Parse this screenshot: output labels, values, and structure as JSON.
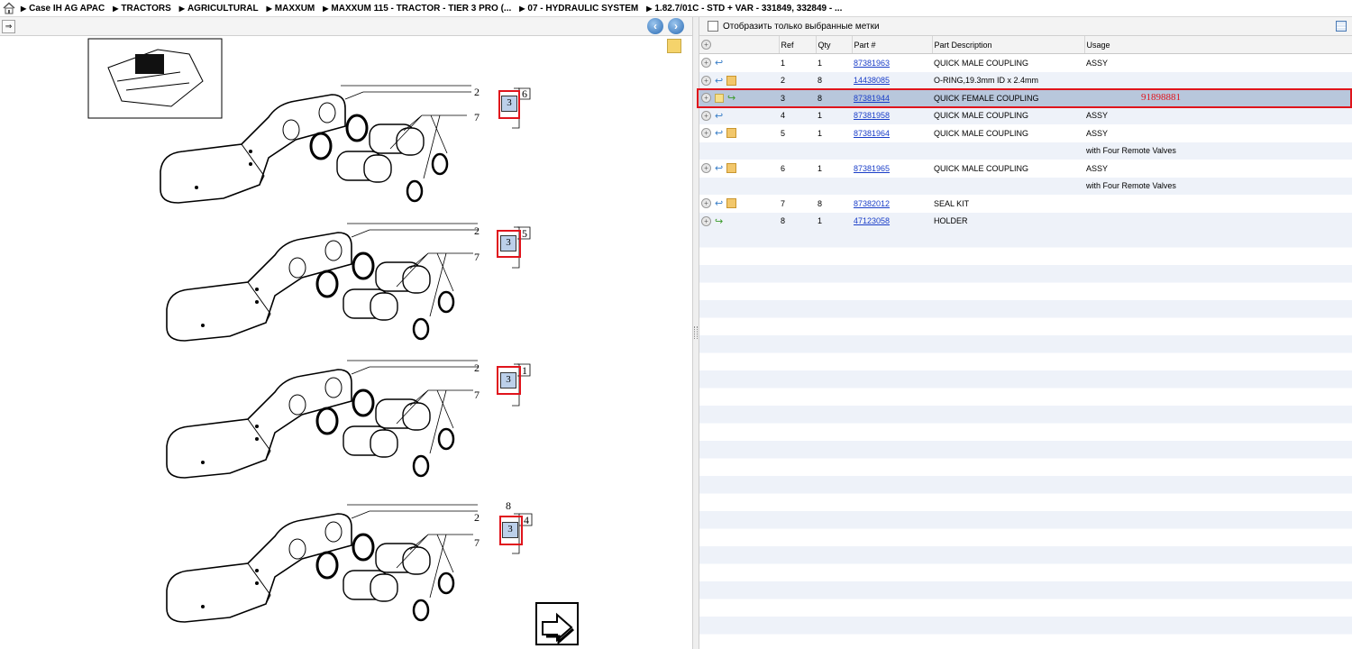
{
  "breadcrumb": [
    {
      "label": "Case IH AG APAC"
    },
    {
      "label": "TRACTORS"
    },
    {
      "label": "AGRICULTURAL"
    },
    {
      "label": "MAXXUM"
    },
    {
      "label": "MAXXUM 115 - TRACTOR - TIER 3 PRO (..."
    },
    {
      "label": "07 - HYDRAULIC SYSTEM"
    },
    {
      "label": "1.82.7/01C - STD + VAR - 331849, 332849 - ..."
    }
  ],
  "drawing": {
    "callouts": [
      "3",
      "3",
      "3",
      "3"
    ],
    "group_numbers": [
      "6",
      "5",
      "1",
      "4"
    ],
    "labels": [
      "2",
      "7"
    ],
    "holder_number": "8"
  },
  "right_panel": {
    "filter_label": "Отобразить только выбранные метки"
  },
  "table": {
    "headers": {
      "ref": "Ref",
      "qty": "Qty",
      "part": "Part #",
      "desc": "Part Description",
      "usage": "Usage"
    },
    "rows": [
      {
        "ref": "1",
        "qty": "1",
        "part": "87381963",
        "desc": "QUICK MALE COUPLING",
        "usage": "ASSY"
      },
      {
        "ref": "2",
        "qty": "8",
        "part": "14438085",
        "desc": "O-RING,19.3mm ID x 2.4mm",
        "usage": ""
      },
      {
        "ref": "3",
        "qty": "8",
        "part": "87381944",
        "desc": "QUICK FEMALE COUPLING",
        "usage": ""
      },
      {
        "ref": "4",
        "qty": "1",
        "part": "87381958",
        "desc": "QUICK MALE COUPLING",
        "usage": "ASSY"
      },
      {
        "ref": "5",
        "qty": "1",
        "part": "87381964",
        "desc": "QUICK MALE COUPLING",
        "usage": "ASSY"
      },
      {
        "ref": "",
        "qty": "",
        "part": "",
        "desc": "",
        "usage": "with Four Remote Valves"
      },
      {
        "ref": "6",
        "qty": "1",
        "part": "87381965",
        "desc": "QUICK MALE COUPLING",
        "usage": "ASSY"
      },
      {
        "ref": "",
        "qty": "",
        "part": "",
        "desc": "",
        "usage": "with Four Remote Valves"
      },
      {
        "ref": "7",
        "qty": "8",
        "part": "87382012",
        "desc": "SEAL KIT",
        "usage": ""
      },
      {
        "ref": "8",
        "qty": "1",
        "part": "47123058",
        "desc": "HOLDER",
        "usage": ""
      }
    ]
  },
  "annotation": {
    "text": "91898881"
  },
  "colors": {
    "highlight": "#e0141c",
    "selected_row": "#b8c7dc",
    "link": "#1a3ec8"
  }
}
